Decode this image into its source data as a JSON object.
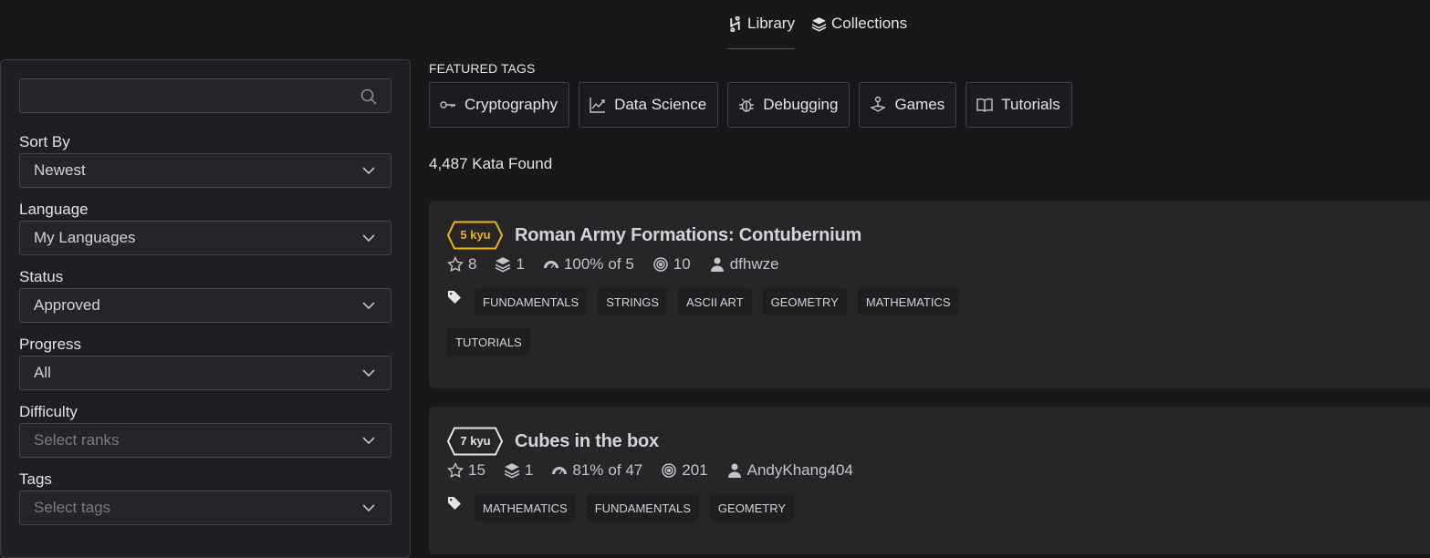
{
  "nav": {
    "tabs": [
      {
        "label": "Library",
        "icon": "library-icon",
        "active": true
      },
      {
        "label": "Collections",
        "icon": "collections-icon",
        "active": false
      }
    ]
  },
  "sidebar": {
    "search": {
      "value": "",
      "placeholder": "",
      "icon": "search-icon"
    },
    "filters": [
      {
        "label": "Sort By",
        "value": "Newest",
        "placeholder": false
      },
      {
        "label": "Language",
        "value": "My Languages",
        "placeholder": false
      },
      {
        "label": "Status",
        "value": "Approved",
        "placeholder": false
      },
      {
        "label": "Progress",
        "value": "All",
        "placeholder": false
      },
      {
        "label": "Difficulty",
        "value": "Select ranks",
        "placeholder": true
      },
      {
        "label": "Tags",
        "value": "Select tags",
        "placeholder": true
      }
    ]
  },
  "main": {
    "featured_label": "FEATURED TAGS",
    "featured_tags": [
      {
        "label": "Cryptography",
        "icon": "key-icon"
      },
      {
        "label": "Data Science",
        "icon": "chart-icon"
      },
      {
        "label": "Debugging",
        "icon": "bug-icon"
      },
      {
        "label": "Games",
        "icon": "joystick-icon"
      },
      {
        "label": "Tutorials",
        "icon": "book-icon"
      }
    ],
    "kata_count": "4,487 Kata Found",
    "katas": [
      {
        "rank": "5 kyu",
        "rank_color": "#ecb613",
        "title": "Roman Army Formations: Contubernium",
        "stars": "8",
        "collections": "1",
        "satisfaction": "100%",
        "satisfaction_of": "of 5",
        "completions": "10",
        "author": "dfhwze",
        "tags": [
          "FUNDAMENTALS",
          "STRINGS",
          "ASCII ART",
          "GEOMETRY",
          "MATHEMATICS",
          "TUTORIALS"
        ]
      },
      {
        "rank": "7 kyu",
        "rank_color": "#e6e6e6",
        "title": "Cubes in the box",
        "stars": "15",
        "collections": "1",
        "satisfaction": "81%",
        "satisfaction_of": "of 47",
        "completions": "201",
        "author": "AndyKhang404",
        "tags": [
          "MATHEMATICS",
          "FUNDAMENTALS",
          "GEOMETRY"
        ]
      }
    ]
  },
  "colors": {
    "accent": "#b1361e",
    "background": "#18181b",
    "card": "#262629"
  }
}
